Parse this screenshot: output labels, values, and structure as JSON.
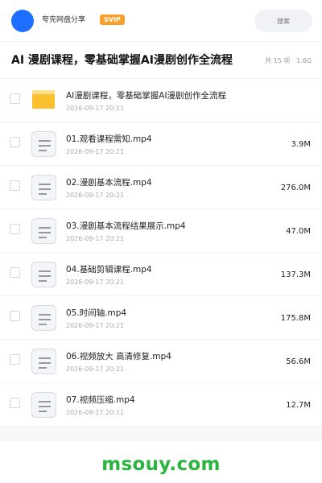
{
  "header": {
    "user_name": "夸克网盘分享",
    "vip_badge": "SVIP",
    "search_placeholder": "搜索"
  },
  "folder": {
    "title": "AI 漫剧课程，零基础掌握AI漫剧创作全流程",
    "meta": "共 15 项 · 1.6G"
  },
  "files": [
    {
      "type": "folder-icon",
      "name": "AI漫剧课程，零基础掌握AI漫剧创作全流程",
      "date": "2026-09-17 20:21",
      "size": ""
    },
    {
      "type": "file-icon",
      "name": "01.观看课程需知.mp4",
      "date": "2026-09-17 20:21",
      "size": "3.9M"
    },
    {
      "type": "file-icon",
      "name": "02.漫剧基本流程.mp4",
      "date": "2026-09-17 20:21",
      "size": "276.0M"
    },
    {
      "type": "file-icon",
      "name": "03.漫剧基本流程结果展示.mp4",
      "date": "2026-09-17 20:21",
      "size": "47.0M"
    },
    {
      "type": "file-icon",
      "name": "04.基础剪辑课程.mp4",
      "date": "2026-09-17 20:21",
      "size": "137.3M"
    },
    {
      "type": "file-icon",
      "name": "05.时间轴.mp4",
      "date": "2026-09-17 20:21",
      "size": "175.8M"
    },
    {
      "type": "file-icon",
      "name": "06.视频放大 高清修复.mp4",
      "date": "2026-09-17 20:21",
      "size": "56.6M"
    },
    {
      "type": "file-icon",
      "name": "07.视频压缩.mp4",
      "date": "2026-09-17 20:21",
      "size": "12.7M"
    }
  ],
  "watermark": "msouy.com",
  "colors": {
    "accent": "#1e6fff",
    "vip": "#f7a02a",
    "folder": "#fbc02d",
    "watermark": "#2ab33d"
  }
}
